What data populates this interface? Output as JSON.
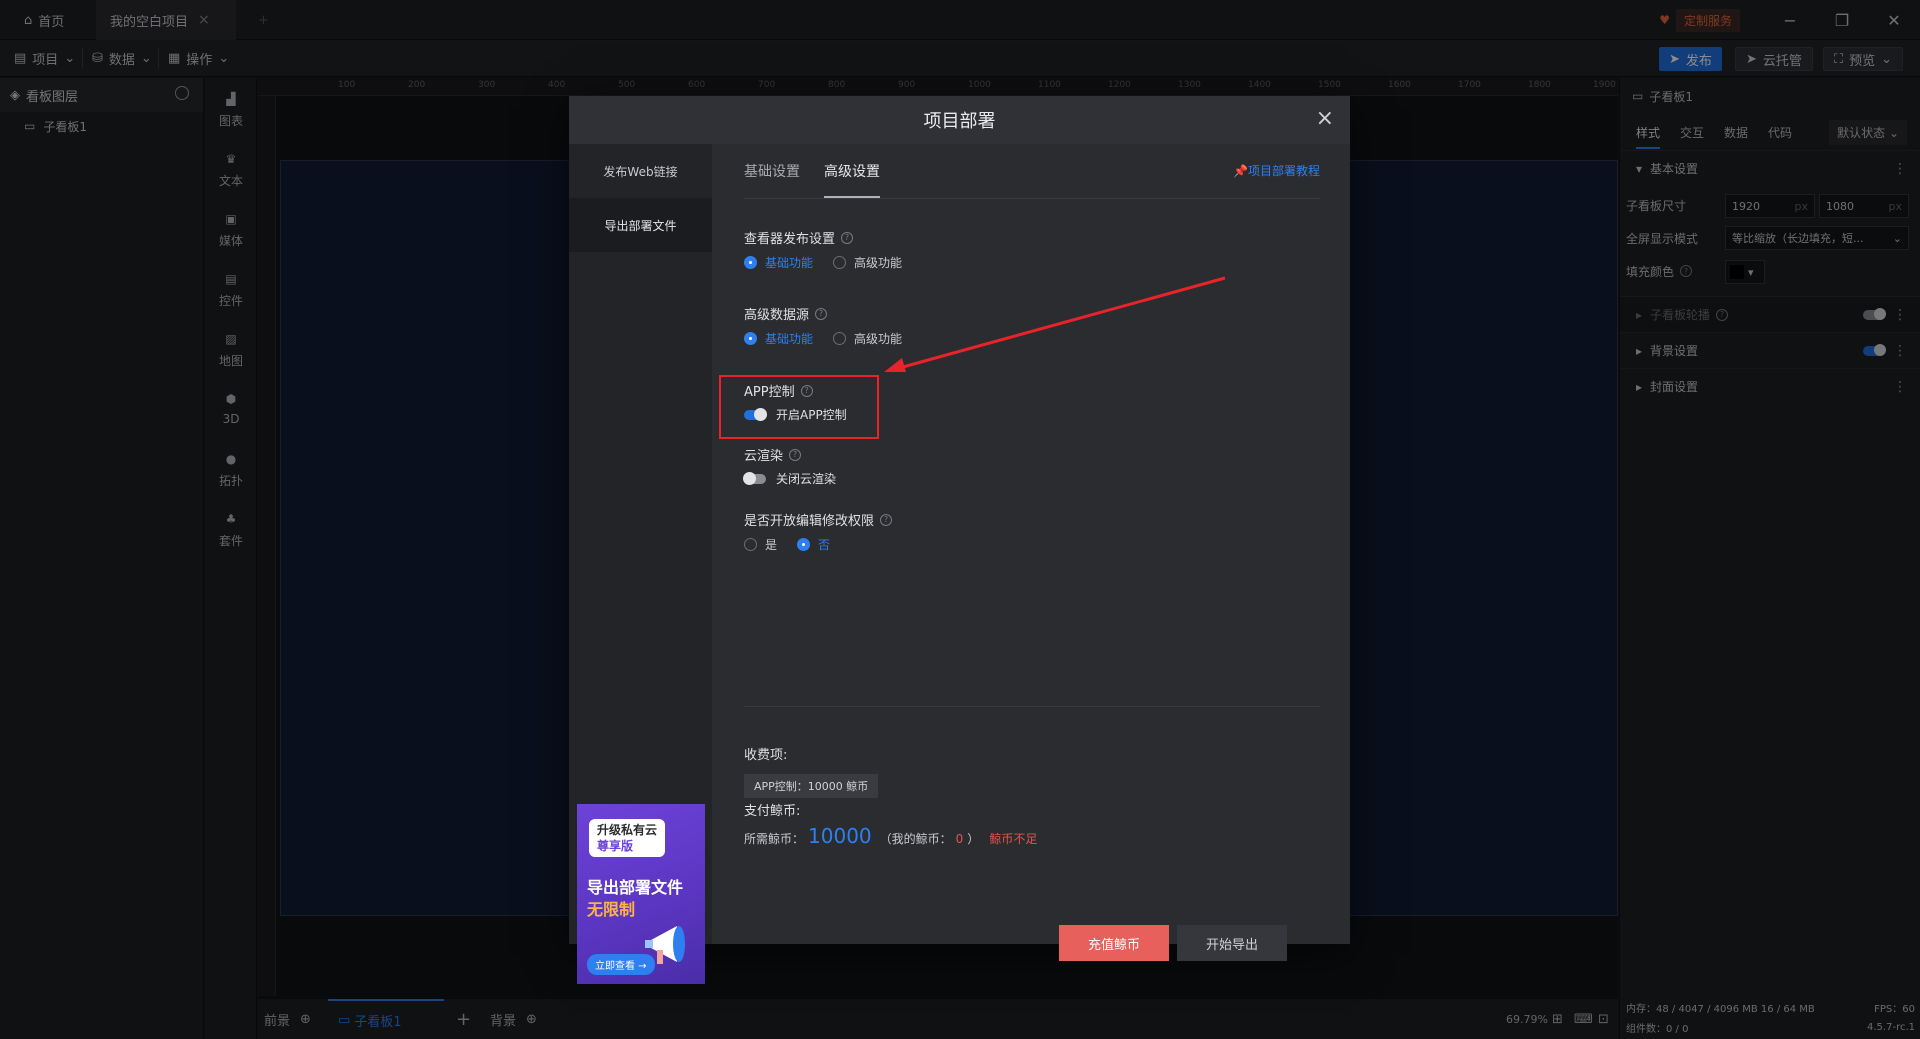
{
  "tabs": {
    "home": "首页",
    "project": "我的空白项目"
  },
  "topbar": {
    "custom_service": "定制服务"
  },
  "toolbar": {
    "menu_project": "项目",
    "menu_data": "数据",
    "menu_ops": "操作",
    "publish": "发布",
    "cloud_host": "云托管",
    "preview": "预览"
  },
  "layers": {
    "title": "看板图层",
    "item": "子看板1"
  },
  "rail": [
    "图表",
    "文本",
    "媒体",
    "控件",
    "地图",
    "3D",
    "拓扑",
    "套件"
  ],
  "ruler": [
    "100",
    "200",
    "300",
    "400",
    "500",
    "600",
    "700",
    "800",
    "900",
    "1000",
    "1100",
    "1200",
    "1300",
    "1400",
    "1500",
    "1600",
    "1700",
    "1800",
    "1900"
  ],
  "bottombar": {
    "front": "前景",
    "board": "子看板1",
    "background": "背景",
    "zoom": "69.79%"
  },
  "right": {
    "title": "子看板1",
    "tabs": [
      "样式",
      "交互",
      "数据",
      "代码"
    ],
    "state": "默认状态",
    "basic": "基本设置",
    "size_label": "子看板尺寸",
    "width": "1920",
    "height": "1080",
    "unit": "px",
    "fullscreen_label": "全屏显示模式",
    "fullscreen_value": "等比缩放（长边填充，短...",
    "fill_label": "填充颜色",
    "carousel": "子看板轮播",
    "bg": "背景设置",
    "cover": "封面设置",
    "memory": "内存：48 / 4047 / 4096 MB 16 / 64 MB",
    "fps": "FPS：60",
    "count": "组件数：0 / 0",
    "version": "4.5.7-rc.1"
  },
  "modal": {
    "title": "项目部署",
    "side": [
      "发布Web链接",
      "导出部署文件"
    ],
    "tabs": [
      "基础设置",
      "高级设置"
    ],
    "tutorial": "项目部署教程",
    "viewer_label": "查看器发布设置",
    "opt_basic": "基础功能",
    "opt_adv": "高级功能",
    "adv_source_label": "高级数据源",
    "app_label": "APP控制",
    "app_switch": "开启APP控制",
    "cloud_label": "云渲染",
    "cloud_switch": "关闭云渲染",
    "edit_label": "是否开放编辑修改权限",
    "yes": "是",
    "no": "否",
    "fee_label": "收费项:",
    "fee_tag": "APP控制：10000 鲸币",
    "pay_label": "支付鲸币:",
    "need_prefix": "所需鲸币：",
    "need_amount": "10000",
    "mine_prefix": "（我的鲸币：",
    "mine_amount": "0",
    "mine_suffix": "）",
    "insufficient": "鲸币不足",
    "recharge": "充值鲸币",
    "start_export": "开始导出"
  },
  "promo": {
    "pill_line1": "升级私有云",
    "pill_line2": "尊享版",
    "title1": "导出部署文件",
    "title2": "无限制",
    "btn": "立即查看 →"
  }
}
